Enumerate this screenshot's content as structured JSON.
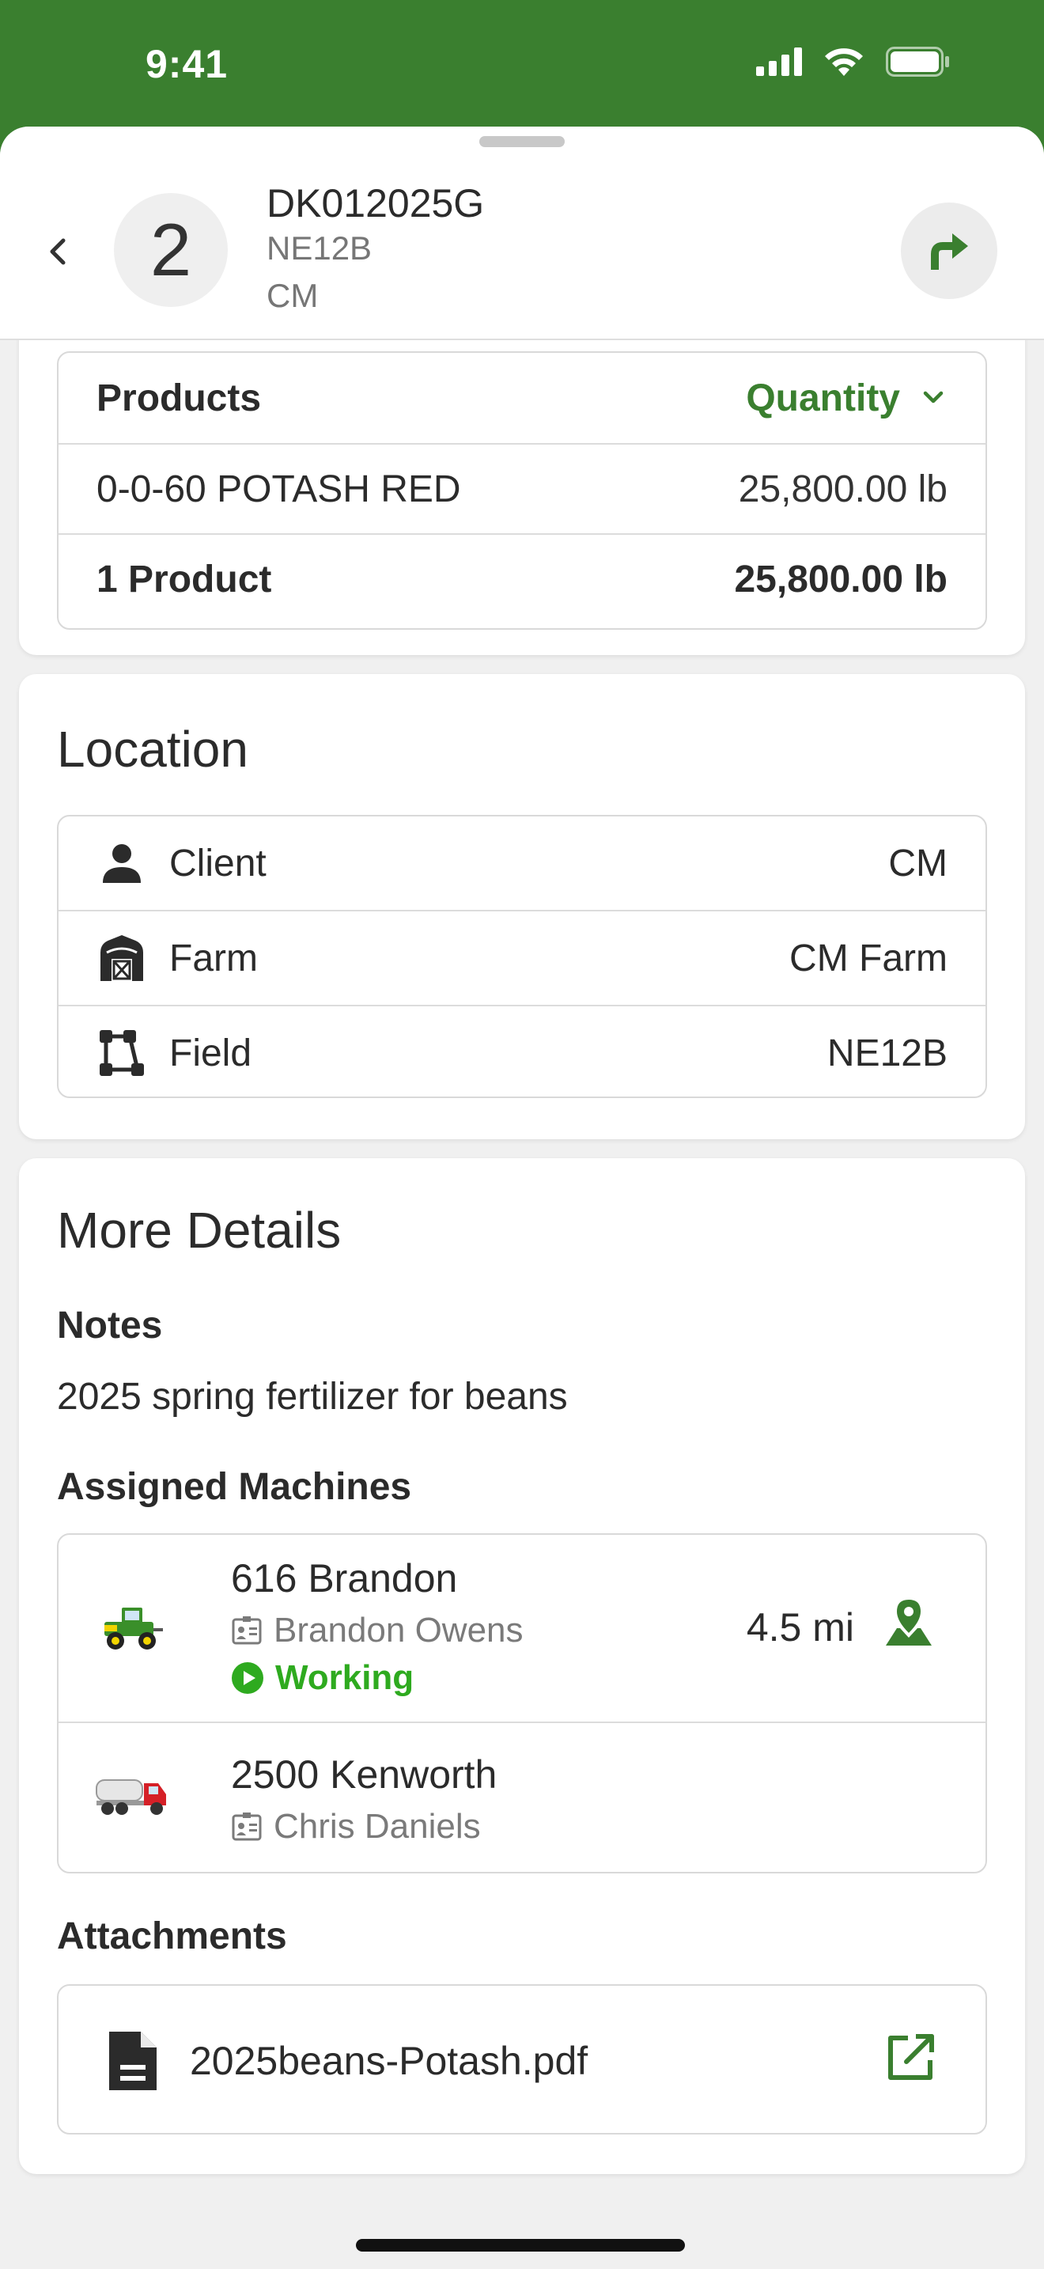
{
  "status_bar": {
    "time": "9:41"
  },
  "header": {
    "stop_number": "2",
    "order_id": "DK012025G",
    "field_code": "NE12B",
    "client_code": "CM"
  },
  "products": {
    "header_label": "Products",
    "sort_label": "Quantity",
    "items": [
      {
        "name": "0-0-60 POTASH RED",
        "quantity": "25,800.00 lb"
      }
    ],
    "total_label": "1 Product",
    "total_quantity": "25,800.00 lb"
  },
  "location": {
    "title": "Location",
    "rows": [
      {
        "label": "Client",
        "value": "CM",
        "icon": "person-icon"
      },
      {
        "label": "Farm",
        "value": "CM Farm",
        "icon": "barn-icon"
      },
      {
        "label": "Field",
        "value": "NE12B",
        "icon": "field-boundary-icon"
      }
    ]
  },
  "details": {
    "title": "More Details",
    "notes_label": "Notes",
    "notes_text": "2025 spring fertilizer for beans",
    "machines_label": "Assigned Machines",
    "machines": [
      {
        "name": "616 Brandon",
        "operator": "Brandon Owens",
        "status": "Working",
        "distance": "4.5 mi",
        "icon": "sprayer-icon"
      },
      {
        "name": "2500 Kenworth",
        "operator": "Chris Daniels",
        "icon": "tender-truck-icon"
      }
    ],
    "attachments_label": "Attachments",
    "attachments": [
      {
        "file_name": "2025beans-Potash.pdf"
      }
    ]
  },
  "colors": {
    "brand_green": "#3a7f2f",
    "status_green": "#2eaa1f",
    "background": "#f0f0f0"
  }
}
